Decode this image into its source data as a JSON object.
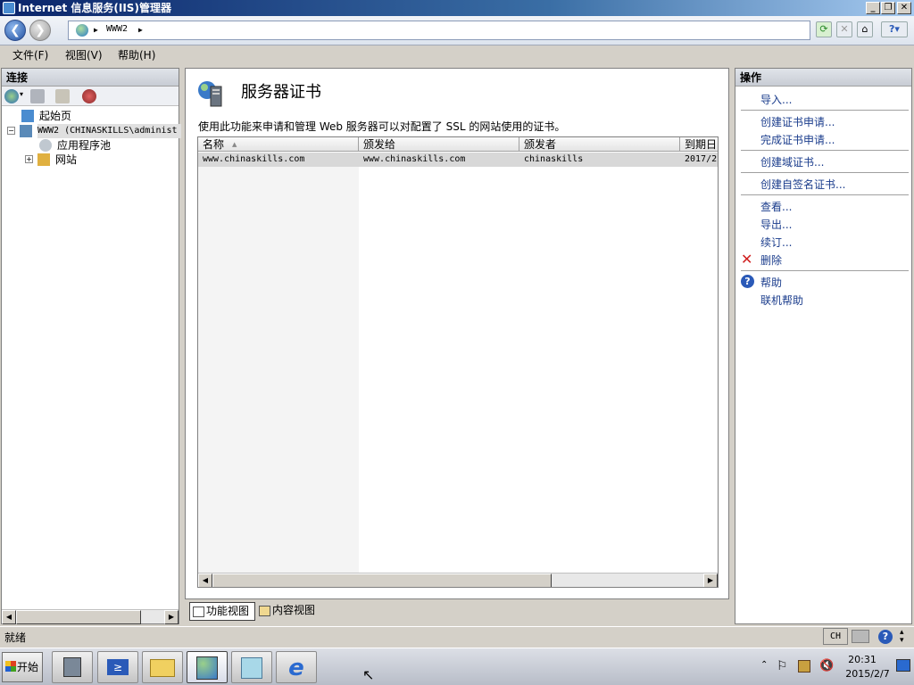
{
  "window": {
    "title": "Internet 信息服务(IIS)管理器"
  },
  "nav": {
    "crumbs": [
      "WWW2"
    ]
  },
  "menu": {
    "items": [
      "文件(F)",
      "视图(V)",
      "帮助(H)"
    ]
  },
  "left": {
    "title": "连接",
    "tree": [
      {
        "label": "起始页"
      },
      {
        "label": "WWW2 (CHINASKILLS\\administ"
      },
      {
        "label": "应用程序池"
      },
      {
        "label": "网站"
      }
    ]
  },
  "center": {
    "title": "服务器证书",
    "description": "使用此功能来申请和管理 Web 服务器可以对配置了 SSL 的网站使用的证书。",
    "columns": [
      "名称",
      "颁发给",
      "颁发者",
      "到期日"
    ],
    "rows": [
      [
        "www.chinaskills.com",
        "www.chinaskills.com",
        "chinaskills",
        "2017/2"
      ]
    ],
    "tabs": [
      "功能视图",
      "内容视图"
    ]
  },
  "right": {
    "title": "操作",
    "actions": [
      "导入...",
      "创建证书申请...",
      "完成证书申请...",
      "创建域证书...",
      "创建自签名证书...",
      "查看...",
      "导出...",
      "续订...",
      "删除",
      "帮助",
      "联机帮助"
    ]
  },
  "status": {
    "text": "就绪",
    "lang": "CH"
  },
  "taskbar": {
    "start": "开始",
    "time": "20:31",
    "date": "2015/2/7"
  },
  "colors": {
    "accent": "#0a246a",
    "link": "#1a3c8c",
    "delete": "#d02020",
    "help": "#2a5ab8"
  }
}
